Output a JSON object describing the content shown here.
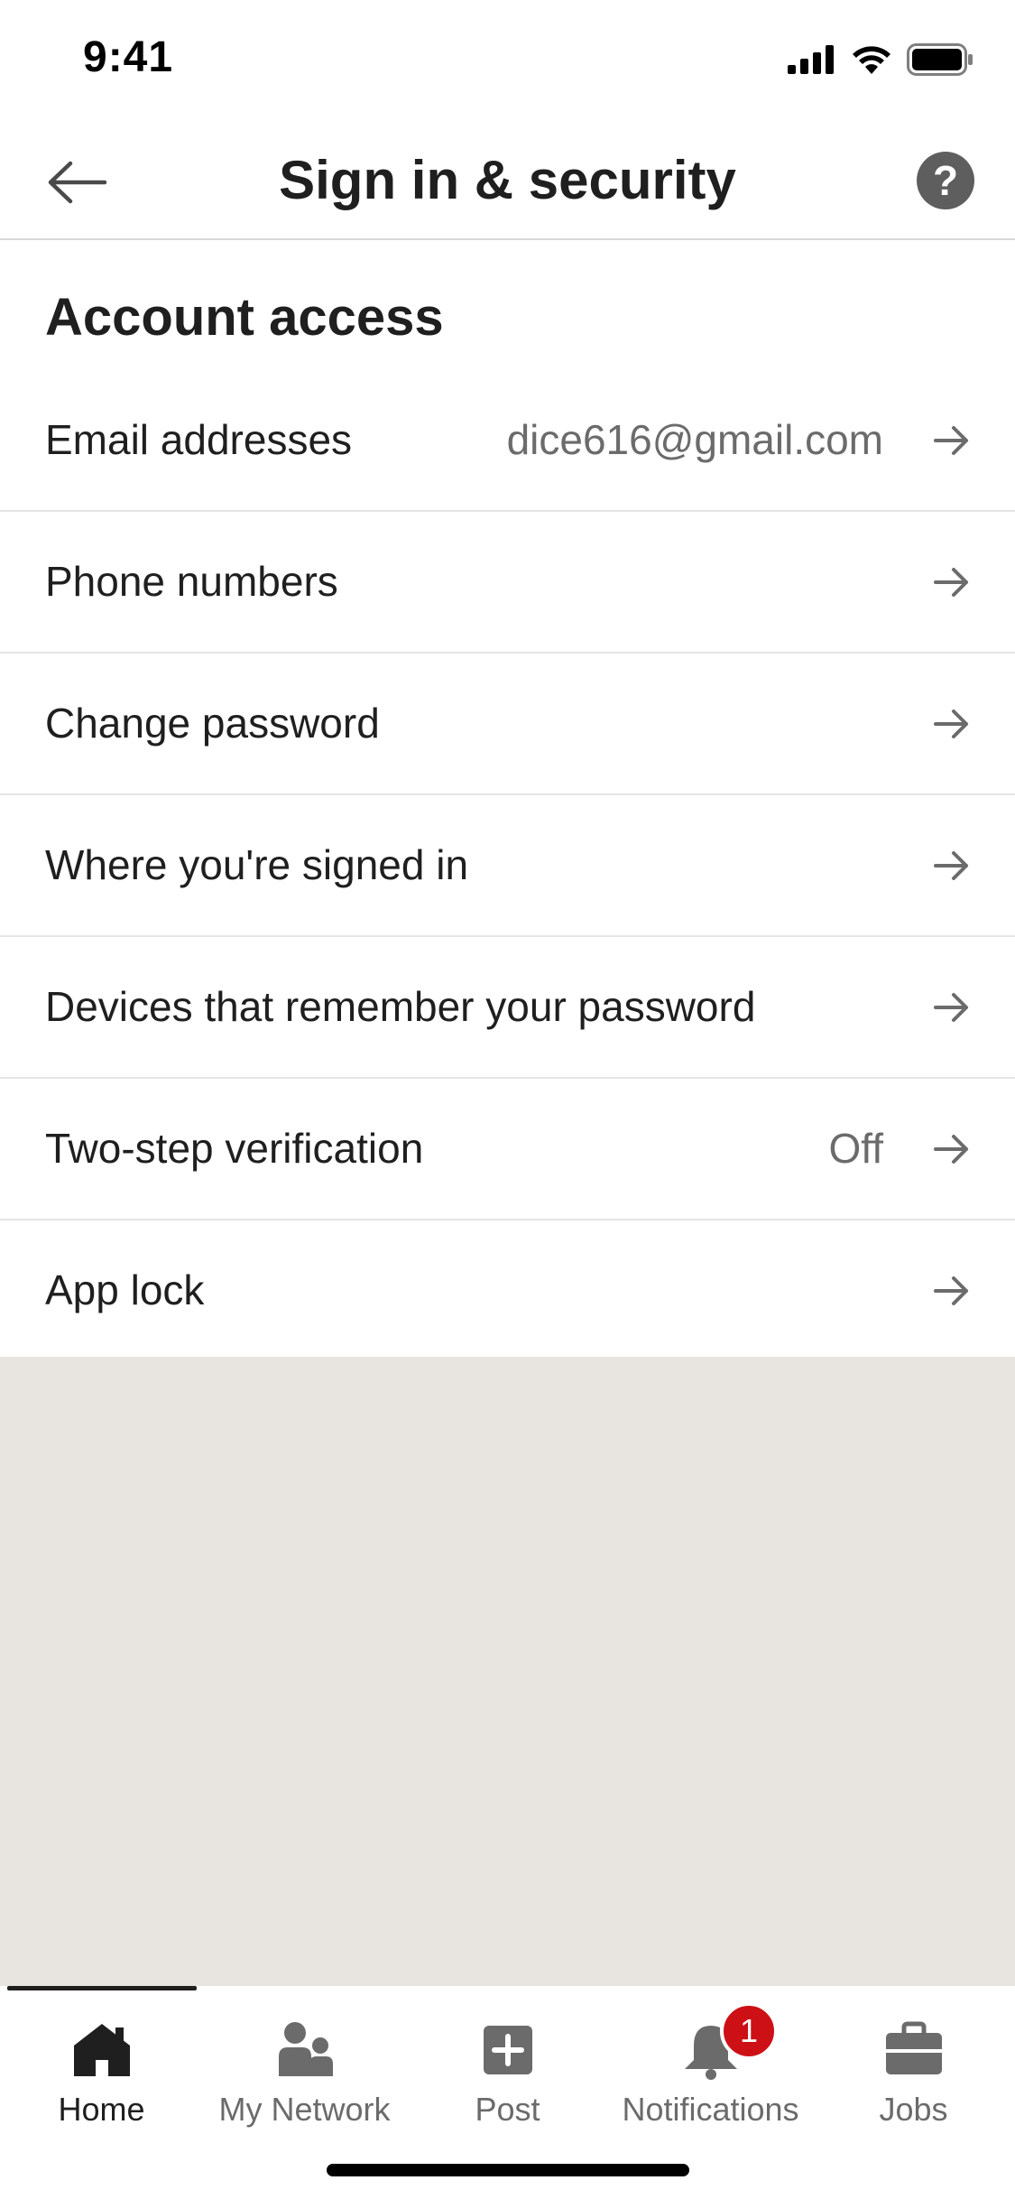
{
  "status_bar": {
    "time": "9:41"
  },
  "header": {
    "title": "Sign in & security"
  },
  "section": {
    "title": "Account access"
  },
  "rows": [
    {
      "label": "Email addresses",
      "value": "dice616@gmail.com"
    },
    {
      "label": "Phone numbers",
      "value": ""
    },
    {
      "label": "Change password",
      "value": ""
    },
    {
      "label": "Where you're signed in",
      "value": ""
    },
    {
      "label": "Devices that remember your password",
      "value": ""
    },
    {
      "label": "Two-step verification",
      "value": "Off"
    },
    {
      "label": "App lock",
      "value": ""
    }
  ],
  "tabs": [
    {
      "label": "Home",
      "icon": "home-icon",
      "active": true
    },
    {
      "label": "My Network",
      "icon": "people-icon"
    },
    {
      "label": "Post",
      "icon": "plus-square-icon"
    },
    {
      "label": "Notifications",
      "icon": "bell-icon",
      "badge": "1"
    },
    {
      "label": "Jobs",
      "icon": "briefcase-icon"
    }
  ],
  "colors": {
    "background": "#ffffff",
    "filler": "#e8e4df",
    "badge": "#cc1016",
    "text_primary": "#1f1f1f",
    "text_secondary": "#6b6b6b"
  }
}
